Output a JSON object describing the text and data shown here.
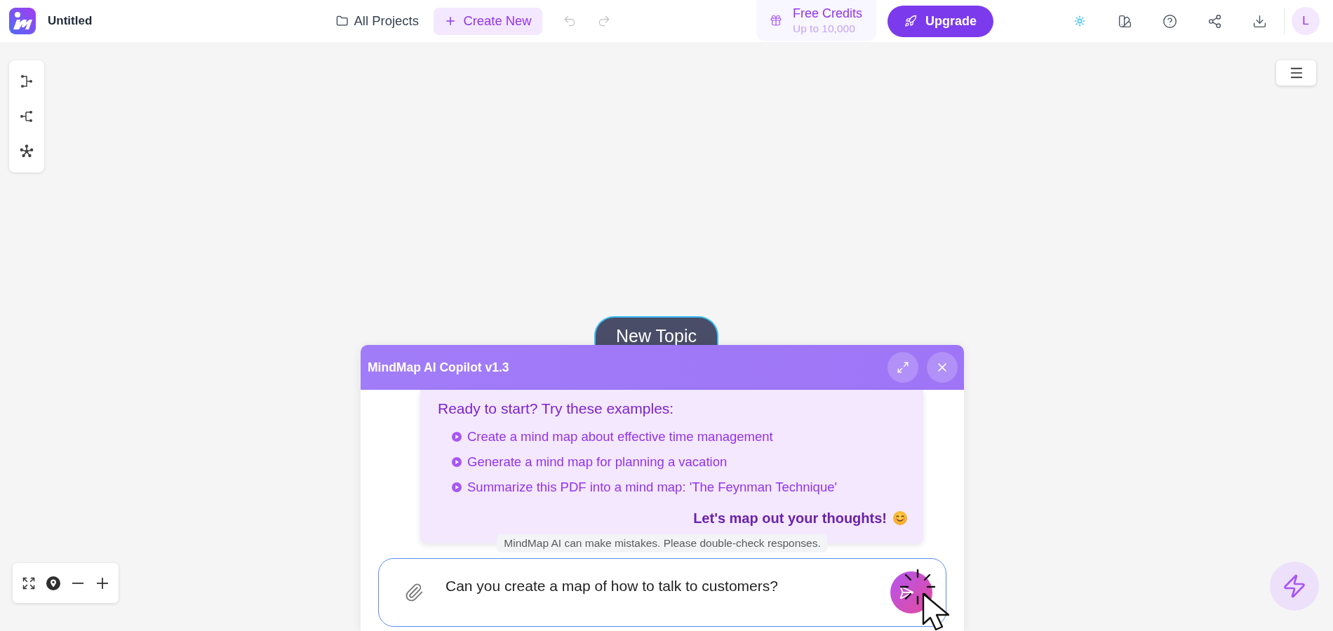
{
  "app": {
    "title": "Untitled"
  },
  "nav": {
    "all_projects": "All Projects",
    "create_new": "Create New",
    "undo": {
      "disabled": true
    },
    "redo": {
      "disabled": true
    }
  },
  "credits": {
    "title": "Free Credits",
    "subtitle": "Up to 10,000"
  },
  "upgrade": {
    "label": "Upgrade"
  },
  "user": {
    "initial": "L"
  },
  "canvas": {
    "topic": "New Topic"
  },
  "copilot": {
    "title": "MindMap AI Copilot v1.3",
    "message": {
      "heading": "Ready to start? Try these examples:",
      "examples": [
        "Create a mind map about effective time management",
        "Generate a mind map for planning a vacation",
        "Summarize this PDF into a mind map: 'The Feynman Technique'"
      ],
      "closing": "Let's map out your thoughts!"
    },
    "disclaimer": "MindMap AI can make mistakes. Please double-check responses.",
    "input": {
      "value": "Can you create a map of how to talk to customers?"
    }
  }
}
